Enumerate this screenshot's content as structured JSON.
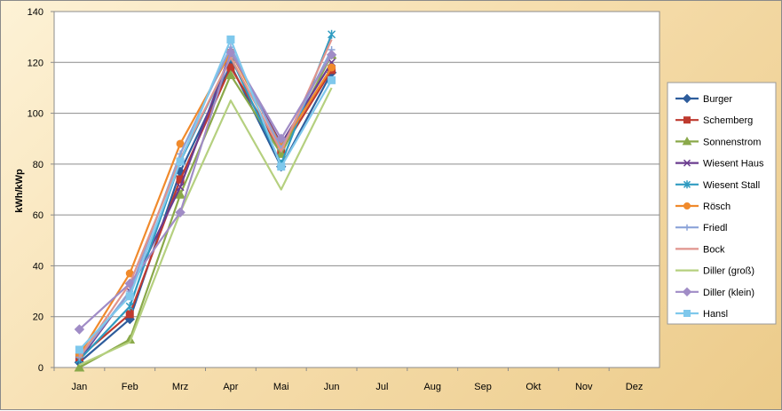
{
  "chart_data": {
    "type": "line",
    "title": "",
    "xlabel": "",
    "ylabel": "kWh/kWp",
    "ylim": [
      0,
      140
    ],
    "yticks": [
      0,
      20,
      40,
      60,
      80,
      100,
      120,
      140
    ],
    "grid": true,
    "legend_position": "right",
    "categories": [
      "Jan",
      "Feb",
      "Mrz",
      "Apr",
      "Mai",
      "Jun",
      "Jul",
      "Aug",
      "Sep",
      "Okt",
      "Nov",
      "Dez"
    ],
    "series": [
      {
        "name": "Burger",
        "color": "#2e5d9c",
        "marker": "diamond",
        "values": [
          2,
          19,
          77,
          119,
          79,
          116
        ]
      },
      {
        "name": "Schemberg",
        "color": "#be3a2f",
        "marker": "square",
        "values": [
          4,
          21,
          74,
          118,
          85,
          117
        ]
      },
      {
        "name": "Sonnenstrom",
        "color": "#8aa94a",
        "marker": "triangle",
        "values": [
          0,
          11,
          68,
          115,
          84,
          123
        ]
      },
      {
        "name": "Wiesent Haus",
        "color": "#6b3d8f",
        "marker": "x",
        "values": [
          3,
          30,
          71,
          124,
          88,
          120
        ]
      },
      {
        "name": "Wiesent Stall",
        "color": "#2f9bc1",
        "marker": "star",
        "values": [
          3,
          24,
          81,
          122,
          80,
          131
        ]
      },
      {
        "name": "Rösch",
        "color": "#f08a2c",
        "marker": "circle",
        "values": [
          5,
          37,
          88,
          124,
          87,
          118
        ]
      },
      {
        "name": "Friedl",
        "color": "#8ba3d8",
        "marker": "plus",
        "values": [
          4,
          30,
          84,
          126,
          86,
          125
        ]
      },
      {
        "name": "Bock",
        "color": "#e0948d",
        "marker": "none",
        "values": [
          4,
          33,
          82,
          122,
          85,
          129
        ]
      },
      {
        "name": "Diller (groß)",
        "color": "#b5d07f",
        "marker": "none",
        "values": [
          1,
          10,
          61,
          105,
          70,
          110
        ]
      },
      {
        "name": "Diller (klein)",
        "color": "#a08cc6",
        "marker": "diamond",
        "values": [
          15,
          33,
          61,
          124,
          90,
          123
        ]
      },
      {
        "name": "Hansl",
        "color": "#7fc8ec",
        "marker": "square",
        "values": [
          7,
          28,
          81,
          129,
          79,
          113
        ]
      }
    ]
  }
}
